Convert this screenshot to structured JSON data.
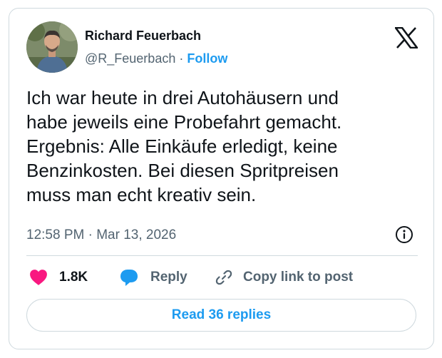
{
  "author": {
    "name": "Richard Feuerbach",
    "handle": "@R_Feuerbach",
    "separator": " · ",
    "follow_label": "Follow"
  },
  "post": {
    "text": "Ich war heute in drei Autohäusern und\nhabe jeweils eine Probefahrt gemacht.\nErgebnis: Alle Einkäufe erledigt, keine\nBenzinkosten. Bei diesen Spritpreisen\nmuss man echt kreativ sein.",
    "timestamp": "12:58 PM · Mar 13, 2026"
  },
  "actions": {
    "likes": "1.8K",
    "reply_label": "Reply",
    "copy_label": "Copy link to post"
  },
  "footer": {
    "read_replies_label": "Read 36 replies"
  },
  "colors": {
    "accent": "#1d9bf0",
    "heart": "#f91880",
    "text": "#0f1419",
    "secondary": "#536471",
    "border": "#cfd9de"
  },
  "icons": {
    "logo": "x-logo-icon",
    "info": "info-icon",
    "like": "heart-icon",
    "reply": "speech-bubble-icon",
    "copy": "link-icon"
  }
}
